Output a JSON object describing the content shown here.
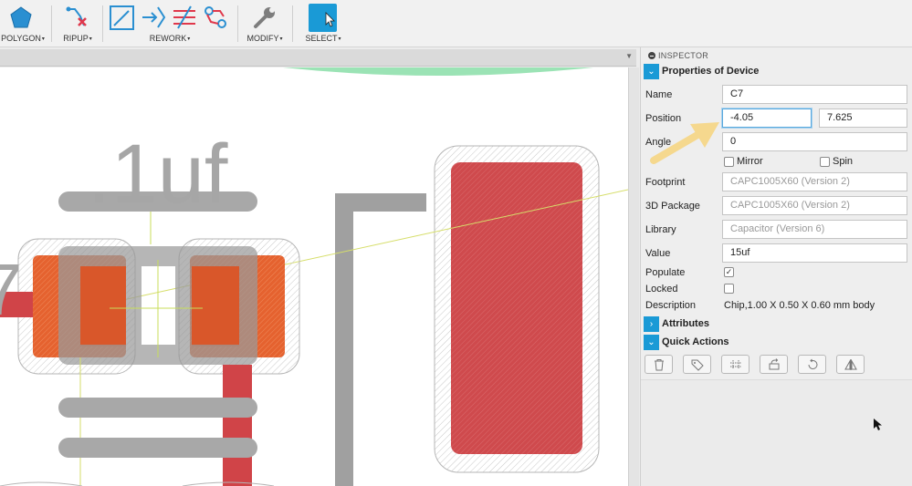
{
  "toolbar": {
    "groups": [
      {
        "label": "POLYGON"
      },
      {
        "label": "RIPUP"
      },
      {
        "label": "REWORK"
      },
      {
        "label": "MODIFY"
      },
      {
        "label": "SELECT"
      }
    ],
    "caret": "▾"
  },
  "canvas": {
    "value_text": ".1uf",
    "partial_label": "7"
  },
  "inspector": {
    "header": "INSPECTOR",
    "sections": {
      "properties": "Properties of Device",
      "attributes": "Attributes",
      "quick_actions": "Quick Actions"
    },
    "fields": {
      "name": {
        "label": "Name",
        "value": "C7"
      },
      "position": {
        "label": "Position",
        "x": "-4.05",
        "y": "7.625"
      },
      "angle": {
        "label": "Angle",
        "value": "0"
      },
      "mirror": {
        "label": "Mirror",
        "checked": false
      },
      "spin": {
        "label": "Spin",
        "checked": false
      },
      "footprint": {
        "label": "Footprint",
        "value": "CAPC1005X60 (Version 2)"
      },
      "package3d": {
        "label": "3D Package",
        "value": "CAPC1005X60 (Version 2)"
      },
      "library": {
        "label": "Library",
        "value": "Capacitor (Version 6)"
      },
      "value": {
        "label": "Value",
        "value": "15uf"
      },
      "populate": {
        "label": "Populate",
        "checked": true,
        "mark": "✓"
      },
      "locked": {
        "label": "Locked",
        "checked": false
      },
      "description": {
        "label": "Description",
        "value": "Chip,1.00 X 0.50 X 0.60 mm body"
      }
    },
    "quick_action_icons": [
      "trash-icon",
      "tag-icon",
      "align-icon",
      "replace-icon",
      "rotate-icon",
      "mirror-icon"
    ]
  },
  "colors": {
    "accent": "#1a9ad6",
    "pad_orange": "#e8622f",
    "pad_red": "#d0464a",
    "silkscreen": "#a8a8a8",
    "annotation_arrow": "#f5d88e"
  }
}
